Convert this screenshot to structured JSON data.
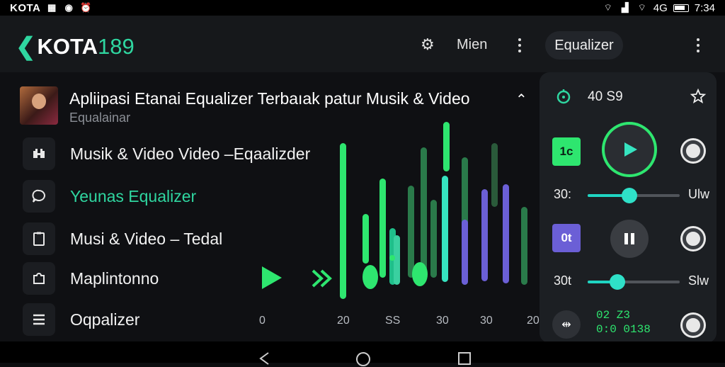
{
  "status": {
    "carrier": "KOTA",
    "signal": "4G",
    "time": "7:34"
  },
  "appbar": {
    "brand_prefix": "KOTA",
    "brand_num": "189",
    "menu_label": "Mien",
    "pill_label": "Equalizer"
  },
  "header": {
    "title": "Apliipasi Etanai Equalizer Terbaıak patur Musik & Video",
    "subtitle": "Equalainar"
  },
  "list": [
    {
      "label": "Musik & Video Video –Eqaalizder",
      "icon": "binoculars-icon",
      "accent": false
    },
    {
      "label": "Yeunas Equalizer",
      "icon": "chat-bubble-icon",
      "accent": true
    },
    {
      "label": "Musi & Video – Tedal",
      "icon": "clipboard-icon",
      "accent": false
    },
    {
      "label": "Maplintonno",
      "icon": "puzzle-icon",
      "accent": false
    },
    {
      "label": "Oqpalizer",
      "icon": "menu-icon",
      "accent": false
    }
  ],
  "chart": {
    "axis_labels": [
      "0",
      "20",
      "SS",
      "30",
      "30",
      "20"
    ]
  },
  "panel": {
    "top_value": "40 S9",
    "square1": "1c",
    "square2": "0t",
    "slider1_left": "30:",
    "slider1_right": "Ulw",
    "slider1_level": 0.45,
    "slider2_left": "30t",
    "slider2_right": "Slw",
    "slider2_level": 0.32,
    "readout_top": "02  Z3",
    "readout_bottom": "0:0   0138",
    "colors": {
      "green": "#2ee66f",
      "teal": "#2fd6a0",
      "purple": "#6b5fd6",
      "panel": "#1c1f23"
    }
  }
}
